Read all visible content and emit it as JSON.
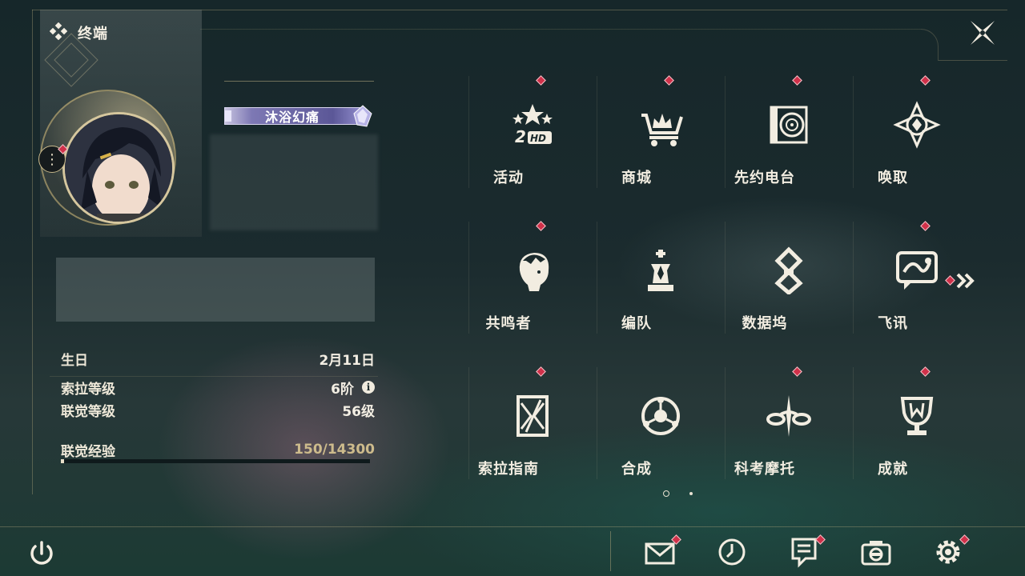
{
  "header": {
    "title": "终端"
  },
  "profile": {
    "badge": "沐浴幻痛",
    "info": [
      {
        "key": "生日",
        "value": "2月11日"
      },
      {
        "key": "索拉等级",
        "value": "6阶"
      },
      {
        "key": "联觉等级",
        "value": "56级"
      }
    ],
    "exp": {
      "label": "联觉经验",
      "value": "150/14300",
      "progress": 0.0105
    }
  },
  "menu": {
    "items": [
      {
        "label": "活动",
        "icon": "event-2hd-icon"
      },
      {
        "label": "商城",
        "icon": "shop-icon"
      },
      {
        "label": "先约电台",
        "icon": "radio-icon"
      },
      {
        "label": "唤取",
        "icon": "convene-icon"
      },
      {
        "label": "共鸣者",
        "icon": "resonator-icon"
      },
      {
        "label": "编队",
        "icon": "team-icon"
      },
      {
        "label": "数据坞",
        "icon": "data-bank-icon"
      },
      {
        "label": "飞讯",
        "icon": "message-icon"
      },
      {
        "label": "索拉指南",
        "icon": "guidebook-icon"
      },
      {
        "label": "合成",
        "icon": "synthesis-icon"
      },
      {
        "label": "科考摩托",
        "icon": "motorcycle-icon"
      },
      {
        "label": "成就",
        "icon": "achievement-icon"
      }
    ]
  },
  "colors": {
    "accent": "#d0314a",
    "gold": "#c9b98c",
    "text": "#f2ede1"
  },
  "bottom_bar": {
    "icons": [
      "mail-icon",
      "clock-icon",
      "notes-icon",
      "camera-icon",
      "settings-icon"
    ]
  }
}
